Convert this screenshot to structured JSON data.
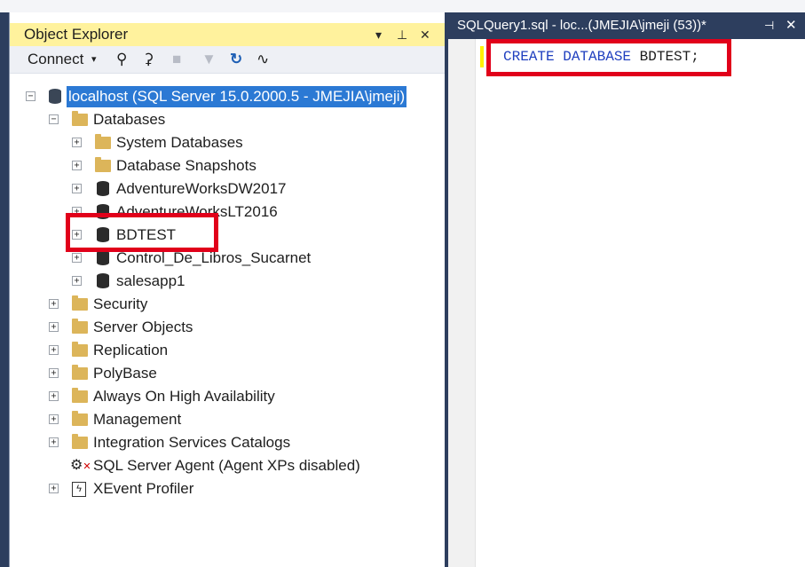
{
  "object_explorer": {
    "title": "Object Explorer",
    "toolbar": {
      "connect": "Connect"
    },
    "tree": {
      "server": "localhost (SQL Server 15.0.2000.5 - JMEJIA\\jmeji)",
      "databases": "Databases",
      "db_items": [
        "System Databases",
        "Database Snapshots",
        "AdventureWorksDW2017",
        "AdventureWorksLT2016",
        "BDTEST",
        "Control_De_Libros_Sucarnet",
        "salesapp1"
      ],
      "top_items": [
        "Security",
        "Server Objects",
        "Replication",
        "PolyBase",
        "Always On High Availability",
        "Management",
        "Integration Services Catalogs"
      ],
      "agent": "SQL Server Agent (Agent XPs disabled)",
      "xevent": "XEvent Profiler"
    }
  },
  "editor": {
    "tab_title": "SQLQuery1.sql - loc...(JMEJIA\\jmeji (53))*",
    "code": {
      "kw1": "CREATE",
      "kw2": "DATABASE",
      "name": "BDTEST",
      "terminator": ";"
    }
  },
  "colors": {
    "highlight": "#e1001a",
    "selection": "#2b79d4",
    "title_bar": "#fff29d",
    "keyword": "#1f3fbf"
  }
}
